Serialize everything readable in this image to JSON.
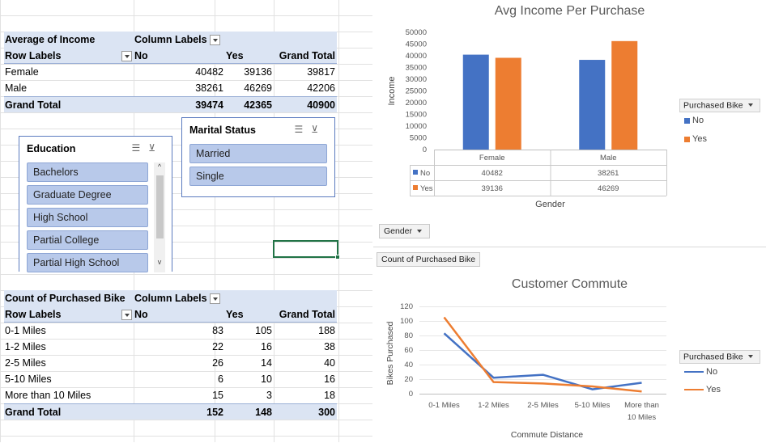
{
  "colors": {
    "no": "#4472c4",
    "yes": "#ed7d31",
    "header_fill": "#dbe4f3",
    "slicer_item": "#b8c9ea"
  },
  "pivot_income": {
    "corner": "Average of Income",
    "col_labels": "Column Labels",
    "row_labels": "Row Labels",
    "col_no": "No",
    "col_yes": "Yes",
    "col_total": "Grand Total",
    "rows": [
      {
        "label": "Female",
        "no": "40482",
        "yes": "39136",
        "total": "39817"
      },
      {
        "label": "Male",
        "no": "38261",
        "yes": "46269",
        "total": "42206"
      }
    ],
    "total": {
      "label": "Grand Total",
      "no": "39474",
      "yes": "42365",
      "total": "40900"
    }
  },
  "pivot_count": {
    "corner": "Count of Purchased Bike",
    "col_labels": "Column Labels",
    "row_labels": "Row Labels",
    "col_no": "No",
    "col_yes": "Yes",
    "col_total": "Grand Total",
    "rows": [
      {
        "label": "0-1 Miles",
        "no": "83",
        "yes": "105",
        "total": "188"
      },
      {
        "label": "1-2 Miles",
        "no": "22",
        "yes": "16",
        "total": "38"
      },
      {
        "label": "2-5 Miles",
        "no": "26",
        "yes": "14",
        "total": "40"
      },
      {
        "label": "5-10 Miles",
        "no": "6",
        "yes": "10",
        "total": "16"
      },
      {
        "label": "More than 10 Miles",
        "no": "15",
        "yes": "3",
        "total": "18"
      }
    ],
    "total": {
      "label": "Grand Total",
      "no": "152",
      "yes": "148",
      "total": "300"
    }
  },
  "slicer_education": {
    "title": "Education",
    "items": [
      "Bachelors",
      "Graduate Degree",
      "High School",
      "Partial College",
      "Partial High School"
    ]
  },
  "slicer_marital": {
    "title": "Marital Status",
    "items": [
      "Married",
      "Single"
    ]
  },
  "chart_data": [
    {
      "type": "bar",
      "title": "Avg Income Per Purchase",
      "xlabel": "Gender",
      "ylabel": "Income",
      "categories": [
        "Female",
        "Male"
      ],
      "series": [
        {
          "name": "No",
          "values": [
            40482,
            38261
          ]
        },
        {
          "name": "Yes",
          "values": [
            39136,
            46269
          ]
        }
      ],
      "ylim": [
        0,
        50000
      ],
      "yticks": [
        "0",
        "5000",
        "10000",
        "15000",
        "20000",
        "25000",
        "30000",
        "35000",
        "40000",
        "45000",
        "50000"
      ],
      "data_table": {
        "rows": [
          {
            "name": "No",
            "values": [
              "40482",
              "38261"
            ]
          },
          {
            "name": "Yes",
            "values": [
              "39136",
              "46269"
            ]
          }
        ]
      },
      "legend_title": "Purchased Bike",
      "legend_position": "right",
      "field_button": "Gender",
      "grid": false
    },
    {
      "type": "line",
      "title": "Customer Commute",
      "xlabel": "Commute Distance",
      "ylabel": "Bikes Purchased",
      "categories": [
        "0-1 Miles",
        "1-2 Miles",
        "2-5 Miles",
        "5-10 Miles",
        "More than 10 Miles"
      ],
      "category_lines": [
        [
          "0-1 Miles"
        ],
        [
          "1-2 Miles"
        ],
        [
          "2-5 Miles"
        ],
        [
          "5-10 Miles"
        ],
        [
          "More than",
          "10 Miles"
        ]
      ],
      "series": [
        {
          "name": "No",
          "values": [
            83,
            22,
            26,
            6,
            15
          ]
        },
        {
          "name": "Yes",
          "values": [
            105,
            16,
            14,
            10,
            3
          ]
        }
      ],
      "ylim": [
        0,
        120
      ],
      "yticks": [
        "0",
        "20",
        "40",
        "60",
        "80",
        "100",
        "120"
      ],
      "legend_title": "Purchased Bike",
      "legend_position": "right",
      "field_button": "Count of Purchased Bike",
      "grid": true
    }
  ]
}
